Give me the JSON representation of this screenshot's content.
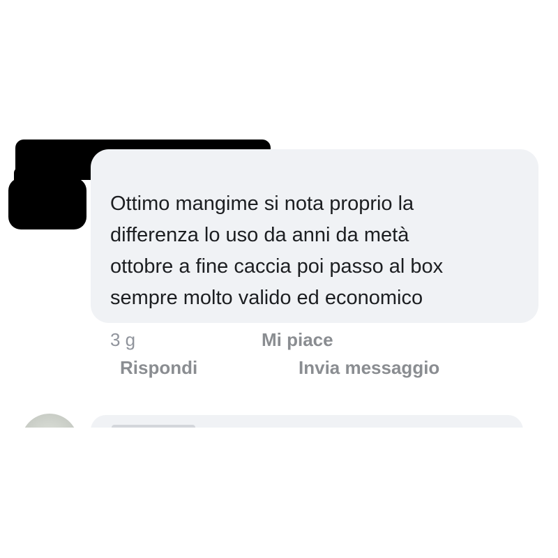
{
  "comment": {
    "lines": [
      "Ottimo mangime si nota proprio la",
      "differenza lo uso da anni da metà",
      "ottobre a fine caccia poi passo al box",
      "sempre molto valido ed economico"
    ],
    "time": "3 g",
    "like_label": "Mi piace",
    "reply_label": "Rispondi",
    "message_label": "Invia messaggio"
  },
  "colors": {
    "bubble": "#f0f2f5",
    "text": "#1c1e21",
    "action": "#8a8d91",
    "redaction": "#000000"
  }
}
